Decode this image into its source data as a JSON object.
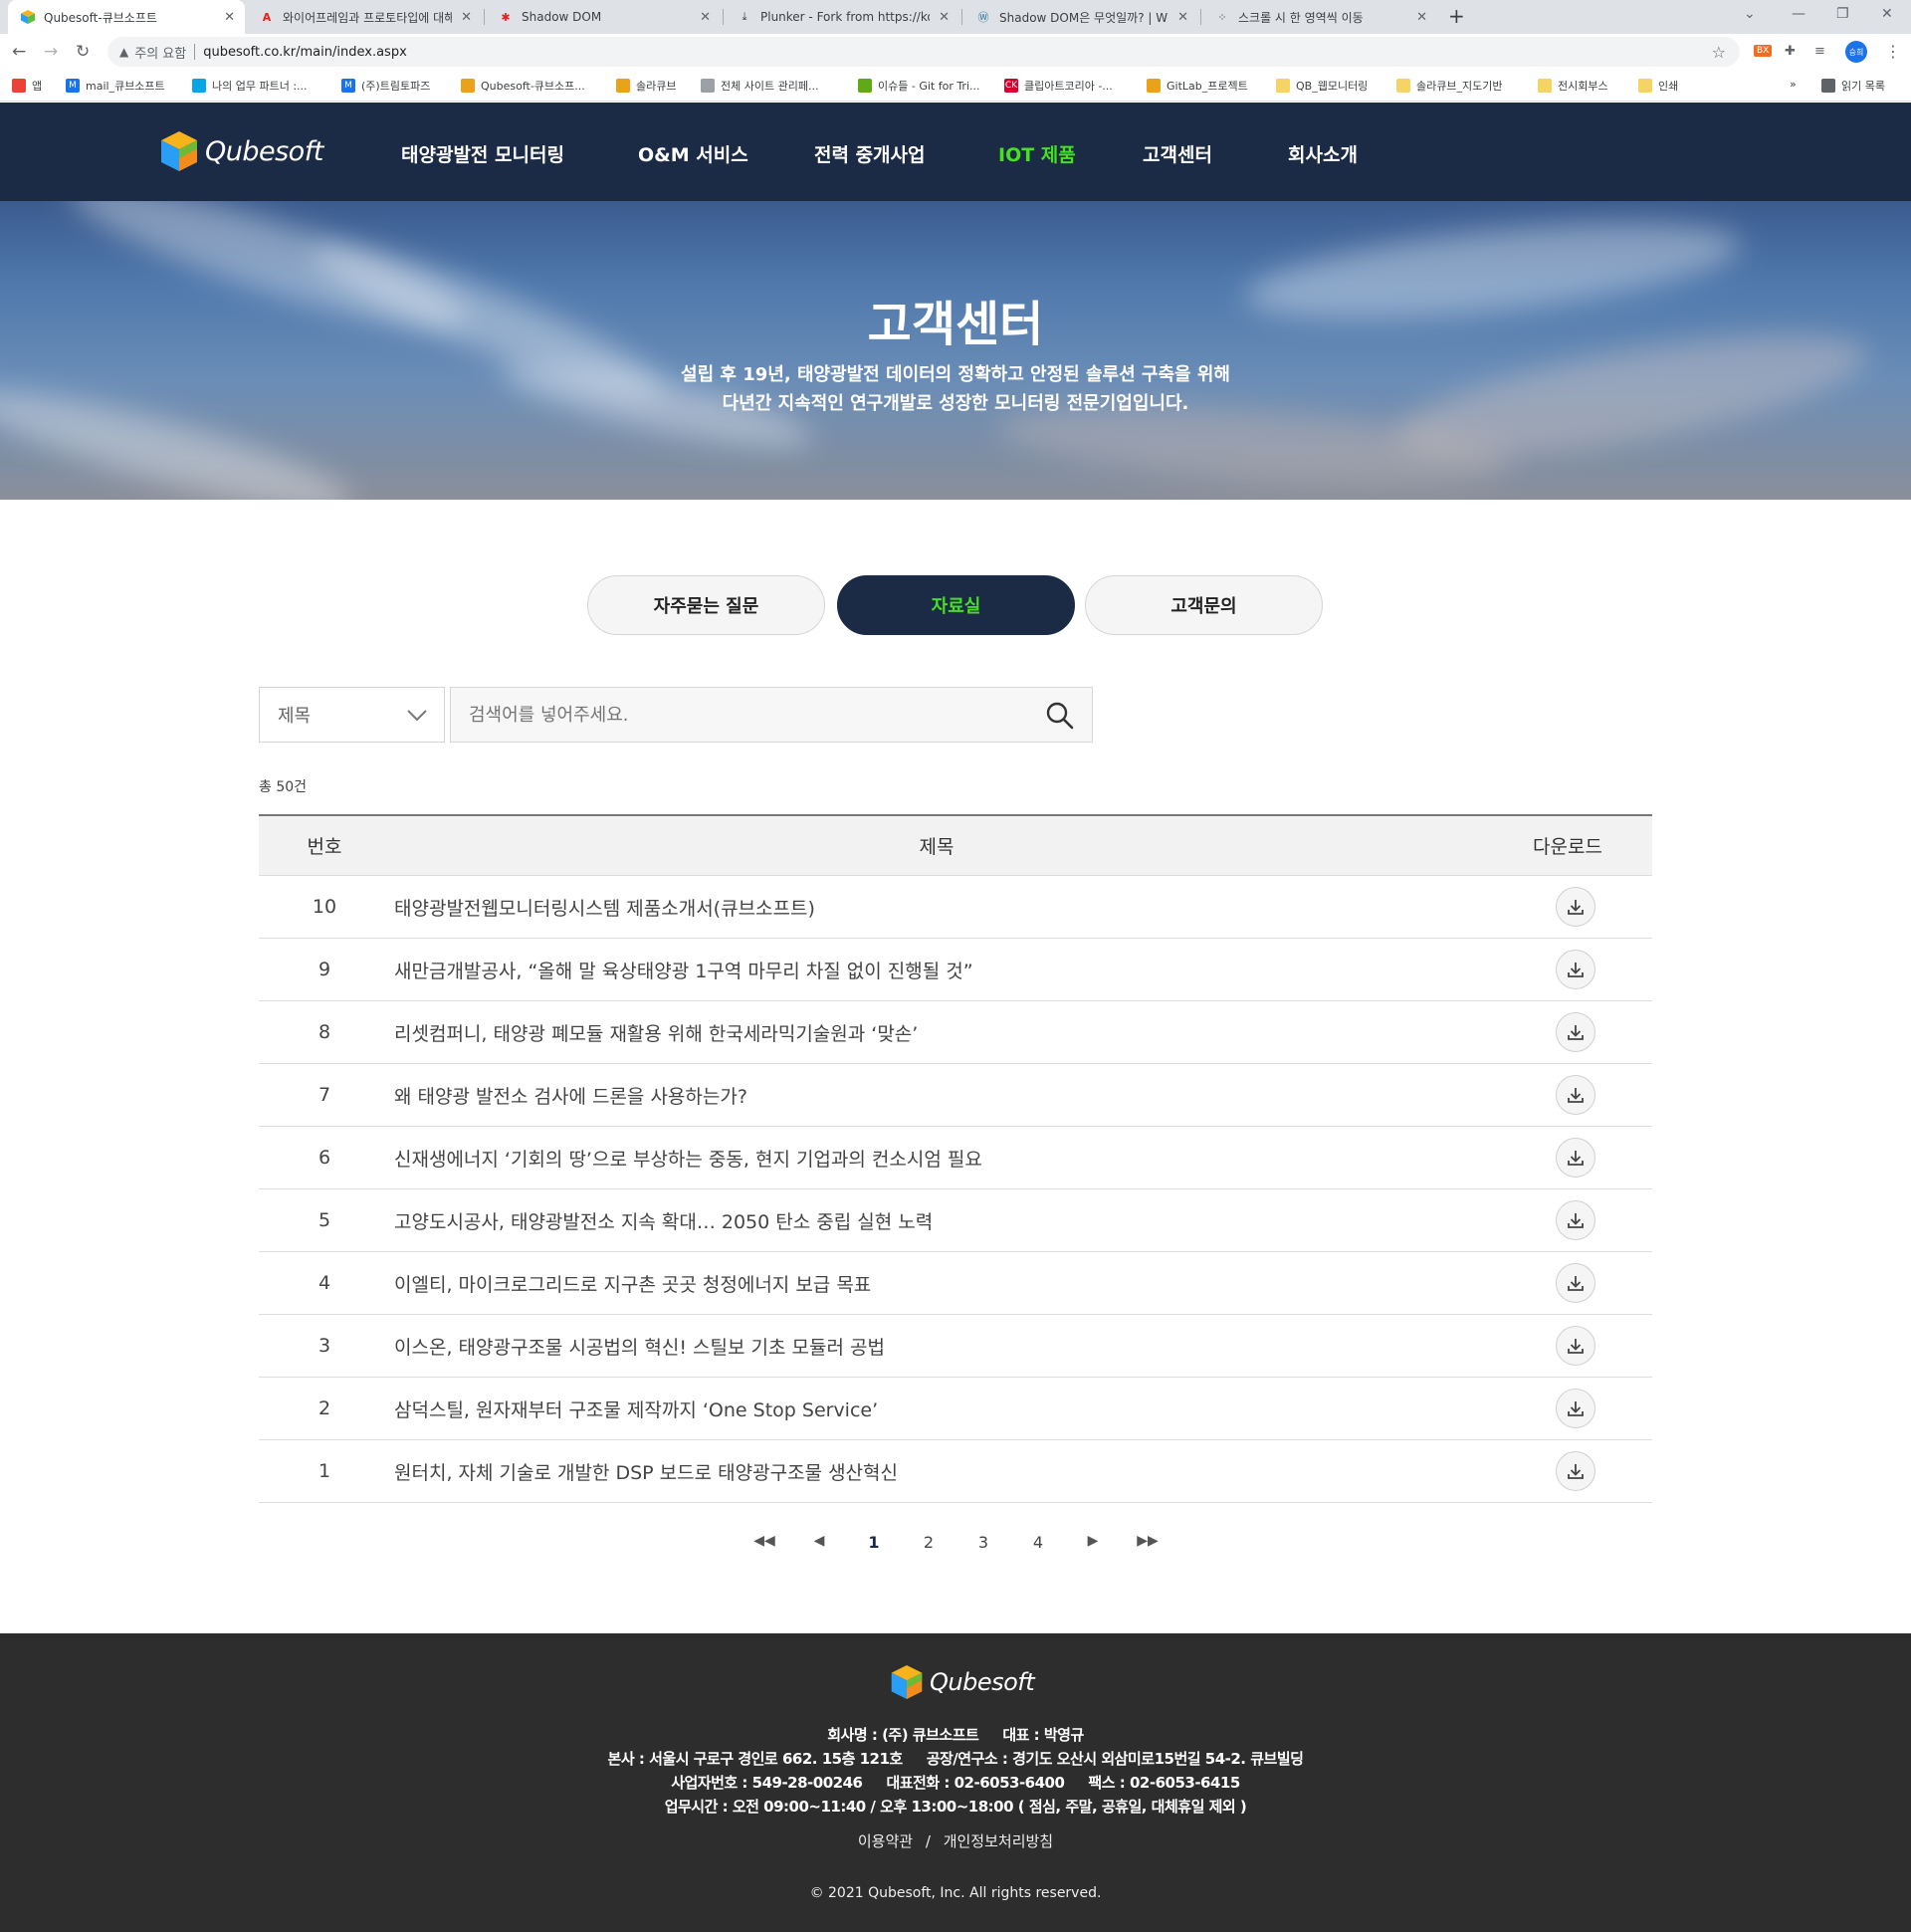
{
  "browser": {
    "tabs": [
      {
        "title": "Qubesoft-큐브소프트",
        "active": true
      },
      {
        "title": "와이어프레임과 프로토타입에 대해",
        "active": false
      },
      {
        "title": "Shadow DOM",
        "active": false
      },
      {
        "title": "Plunker - Fork from https://ko.ja",
        "active": false
      },
      {
        "title": "Shadow DOM은 무엇일까? | WI",
        "active": false
      },
      {
        "title": "스크롤 시 한 영역씩 이동",
        "active": false
      }
    ],
    "security_label": "주의 요함",
    "url": "qubesoft.co.kr/main/index.aspx",
    "profile_initials": "승희",
    "ext_label": "BX",
    "bookmarks": [
      {
        "label": "앱",
        "color": "#4285f4"
      },
      {
        "label": "mail_큐브소프트",
        "color": "#1a73e8"
      },
      {
        "label": "나의 업무 파트너 :...",
        "color": "#0aa5e6"
      },
      {
        "label": "(주)트림토파즈",
        "color": "#1a73e8"
      },
      {
        "label": "Qubesoft-큐브소프...",
        "color": "#e8a31a"
      },
      {
        "label": "솔라큐브",
        "color": "#e8a31a"
      },
      {
        "label": "전체 사이트 관리페...",
        "color": "#9aa0a6"
      },
      {
        "label": "이슈들 - Git for Tri...",
        "color": "#60a917"
      },
      {
        "label": "클립아트코리아 -...",
        "color": "#d5002f"
      },
      {
        "label": "GitLab_프로젝트",
        "color": "#e8a31a"
      },
      {
        "label": "QB_웹모니터링",
        "color": "#f6d365"
      },
      {
        "label": "솔라큐브_지도기반",
        "color": "#f6d365"
      },
      {
        "label": "전시회부스",
        "color": "#f6d365"
      },
      {
        "label": "인쇄",
        "color": "#f6d365"
      }
    ],
    "reading_list": "읽기 목록"
  },
  "header": {
    "logo_text": "Qubesoft",
    "nav": [
      {
        "label": "태양광발전 모니터링",
        "active": false
      },
      {
        "label": "O&M 서비스",
        "active": false
      },
      {
        "label": "전력 중개사업",
        "active": false
      },
      {
        "label": "IOT 제품",
        "active": true
      },
      {
        "label": "고객센터",
        "active": false
      },
      {
        "label": "회사소개",
        "active": false
      }
    ]
  },
  "hero": {
    "title": "고객센터",
    "desc_line1": "설립 후 19년, 태양광발전 데이터의 정확하고 안정된 솔루션 구축을 위해",
    "desc_line2": "다년간 지속적인 연구개발로 성장한 모니터링 전문기업입니다."
  },
  "subtabs": [
    {
      "label": "자주묻는 질문",
      "active": false
    },
    {
      "label": "자료실",
      "active": true
    },
    {
      "label": "고객문의",
      "active": false
    }
  ],
  "search": {
    "select_value": "제목",
    "placeholder": "검색어를 넣어주세요."
  },
  "total_label": "총 50건",
  "table": {
    "headers": {
      "no": "번호",
      "title": "제목",
      "download": "다운로드"
    },
    "rows": [
      {
        "no": "10",
        "title": "태양광발전웹모니터링시스템 제품소개서(큐브소프트)"
      },
      {
        "no": "9",
        "title": "새만금개발공사, “올해 말 육상태양광 1구역 마무리 차질 없이 진행될 것”"
      },
      {
        "no": "8",
        "title": "리셋컴퍼니, 태양광 폐모듈 재활용 위해 한국세라믹기술원과 ‘맞손’"
      },
      {
        "no": "7",
        "title": "왜 태양광 발전소 검사에 드론을 사용하는가?"
      },
      {
        "no": "6",
        "title": "신재생에너지 ‘기회의 땅’으로 부상하는 중동, 현지 기업과의 컨소시엄 필요"
      },
      {
        "no": "5",
        "title": "고양도시공사, 태양광발전소 지속 확대… 2050 탄소 중립 실현 노력"
      },
      {
        "no": "4",
        "title": "이엘티, 마이크로그리드로 지구촌 곳곳 청정에너지 보급 목표"
      },
      {
        "no": "3",
        "title": "이스온, 태양광구조물 시공법의 혁신! 스틸보 기초 모듈러 공법"
      },
      {
        "no": "2",
        "title": "삼덕스틸, 원자재부터 구조물 제작까지 ‘One Stop Service’"
      },
      {
        "no": "1",
        "title": "원터치, 자체 기술로 개발한 DSP 보드로 태양광구조물 생산혁신"
      }
    ]
  },
  "pager": {
    "first": "◀◀",
    "prev": "◀",
    "pages": [
      "1",
      "2",
      "3",
      "4"
    ],
    "current": "1",
    "next": "▶",
    "last": "▶▶"
  },
  "footer": {
    "logo_text": "Qubesoft",
    "company": "회사명 : (주) 큐브소프트",
    "ceo": "대표 : 박영규",
    "hq": "본사 : 서울시 구로구 경인로 662. 15층 121호",
    "factory": "공장/연구소 : 경기도 오산시 외삼미로15번길 54-2. 큐브빌딩",
    "bizno": "사업자번호 : 549-28-00246",
    "tel": "대표전화 : 02-6053-6400",
    "fax": "팩스 : 02-6053-6415",
    "hours": "업무시간 : 오전 09:00~11:40 / 오후 13:00~18:00 ( 점심, 주말, 공휴일, 대체휴일 제외 )",
    "terms": "이용약관",
    "privacy": "개인정보처리방침",
    "link_sep": "/",
    "copyright": "© 2021 Qubesoft, Inc. All rights reserved."
  },
  "colors": {
    "navy": "#1b2a45",
    "accent_green": "#46e020",
    "footer_bg": "#2d2d2d"
  }
}
